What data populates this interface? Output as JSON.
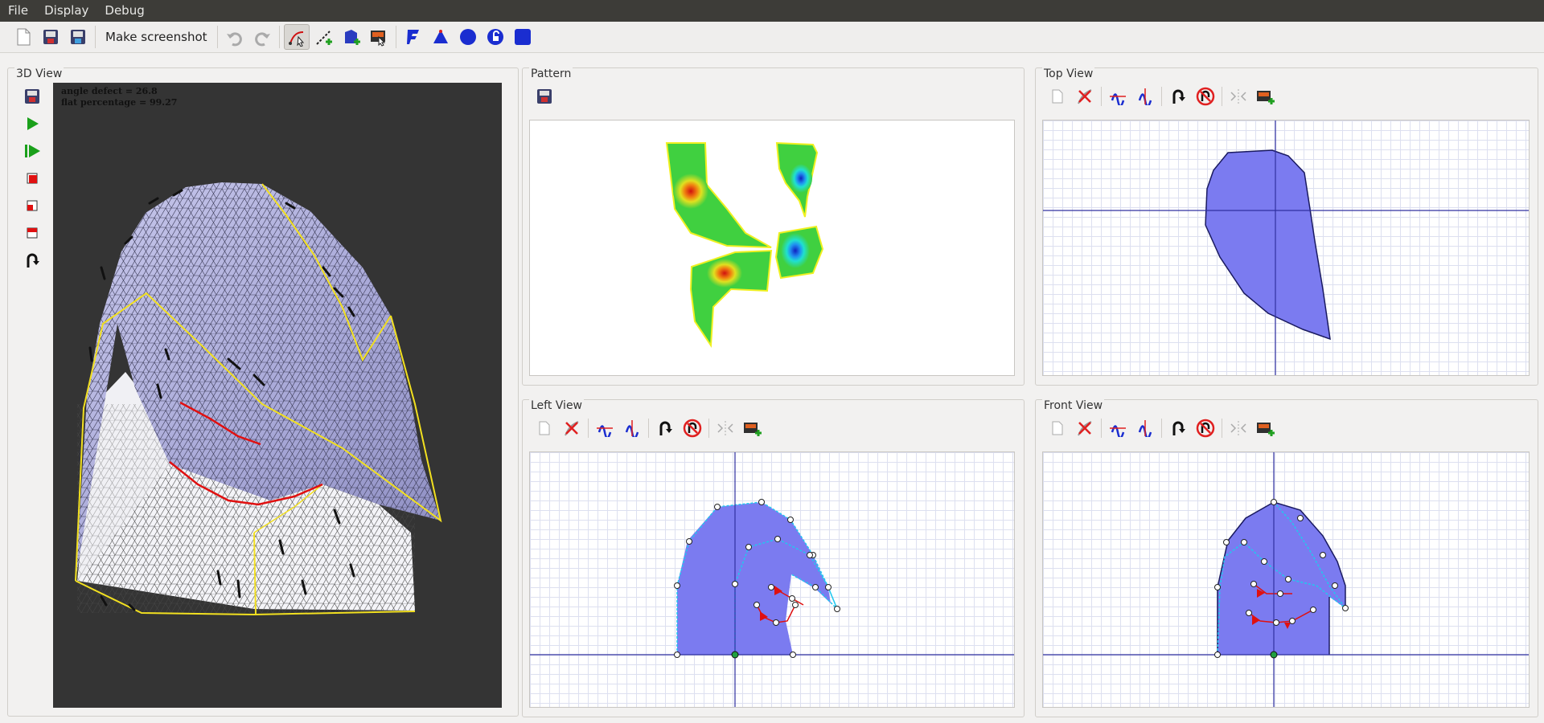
{
  "menu": {
    "file": "File",
    "display": "Display",
    "debug": "Debug"
  },
  "toolbar": {
    "screenshot_label": "Make screenshot"
  },
  "panels": {
    "view3d": "3D View",
    "pattern": "Pattern",
    "top": "Top View",
    "left": "Left View",
    "front": "Front View"
  },
  "stats": {
    "angle_defect": "angle defect = 26.8",
    "flat_percentage": "flat percentage = 99.27"
  },
  "colors": {
    "shape_fill": "#7b7bf0",
    "axis": "#3030a0",
    "seam": "#f2e020",
    "cut": "#e01010",
    "curve": "#20c8f0"
  }
}
